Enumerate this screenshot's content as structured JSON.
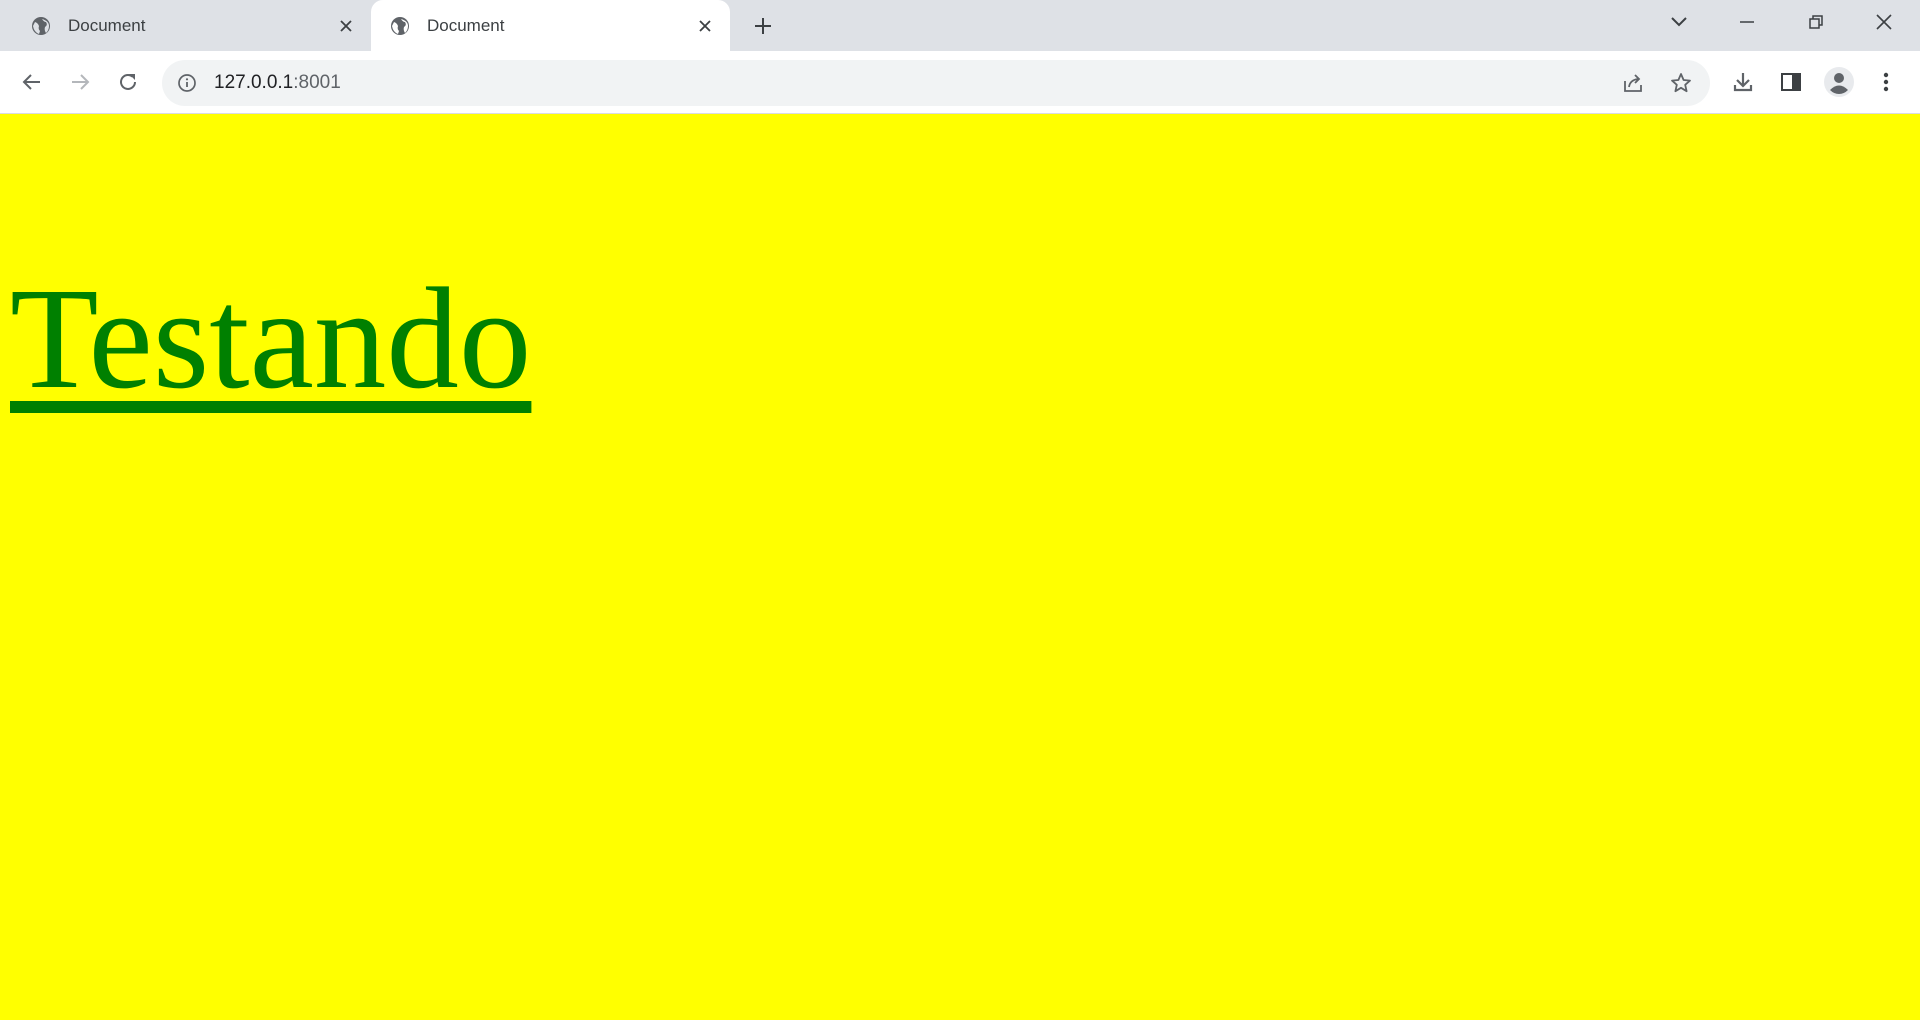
{
  "tabs": [
    {
      "title": "Document",
      "active": false
    },
    {
      "title": "Document",
      "active": true
    }
  ],
  "omnibox": {
    "host": "127.0.0.1",
    "port": ":8001"
  },
  "page": {
    "heading": "Testando",
    "background_color": "#ffff00",
    "heading_color": "#008000"
  },
  "icons": {
    "tab_favicon": "globe-icon",
    "tab_close": "close-icon",
    "new_tab": "plus-icon",
    "tab_search": "chevron-down-icon",
    "minimize": "minimize-icon",
    "restore": "restore-icon",
    "close_window": "close-icon",
    "back": "back-arrow-icon",
    "forward": "forward-arrow-icon",
    "reload": "reload-icon",
    "site_info": "info-icon",
    "share": "share-icon",
    "bookmark": "star-icon",
    "downloads": "download-icon",
    "side_panel": "side-panel-icon",
    "profile": "profile-icon",
    "menu": "kebab-menu-icon"
  }
}
